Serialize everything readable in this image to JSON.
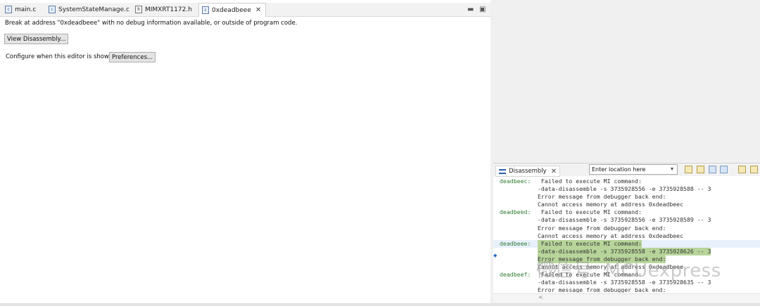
{
  "tabs": [
    {
      "label": "main.c",
      "icon": "c-file-icon"
    },
    {
      "label": "SystemStateManage.c",
      "icon": "c-file-icon"
    },
    {
      "label": "MIMXRT1172.h",
      "icon": "h-file-icon"
    },
    {
      "label": "0xdeadbeee",
      "icon": "c-file-icon",
      "active": true
    }
  ],
  "editor": {
    "message": "Break at address \"0xdeadbeee\" with no debug information available, or outside of program code.",
    "view_disassembly": "View Disassembly...",
    "configure_label": "Configure when this editor is shown",
    "preferences": "Preferences..."
  },
  "disassembly": {
    "title": "Disassembly",
    "location_placeholder": "Enter location here",
    "lines": [
      {
        "addr": "deadbeec:",
        "text": " Failed to execute MI command:"
      },
      {
        "addr": "",
        "text": "-data-disassemble -s 3735928556 -e 3735928588 -- 3"
      },
      {
        "addr": "",
        "text": "Error message from debugger back end:"
      },
      {
        "addr": "",
        "text": "Cannot access memory at address 0xdeadbeec"
      },
      {
        "addr": "deadbeed:",
        "text": " Failed to execute MI command:"
      },
      {
        "addr": "",
        "text": "-data-disassemble -s 3735928556 -e 3735928589 -- 3"
      },
      {
        "addr": "",
        "text": "Error message from debugger back end:"
      },
      {
        "addr": "",
        "text": "Cannot access memory at address 0xdeadbeec"
      },
      {
        "addr": "deadbeee:",
        "text": " Failed to execute MI command:"
      },
      {
        "addr": "",
        "text": "-data-disassemble -s 3735928558 -e 3735928626 -- 3"
      },
      {
        "addr": "",
        "text": "Error message from debugger back end:"
      },
      {
        "addr": "",
        "text": "Cannot access memory at address 0xdeadbeee"
      },
      {
        "addr": "deadbeef:",
        "text": " Failed to execute MI command:"
      },
      {
        "addr": "",
        "text": "-data-disassemble -s 3735928558 -e 3735928635 -- 3"
      },
      {
        "addr": "",
        "text": "Error message from debugger back end:"
      }
    ]
  },
  "watermark": "微信号: MCUexpress",
  "colors": {
    "address": "#2e7d32",
    "highlight": "#b7d59a",
    "current_line": "#e8f0fb"
  }
}
